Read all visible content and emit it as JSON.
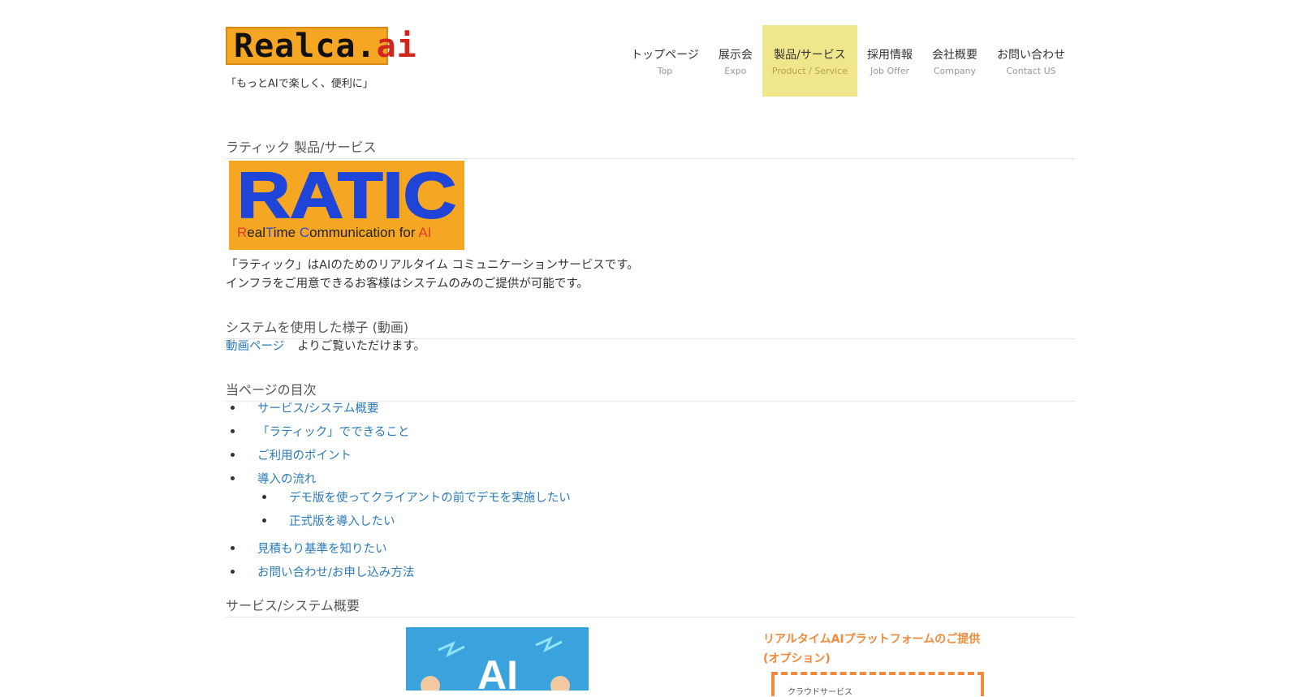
{
  "header": {
    "logo_main": "Realca.",
    "logo_accent": "ai",
    "tagline": "「もっとAIで楽しく、便利に」"
  },
  "nav": [
    {
      "jp": "トップページ",
      "en": "Top"
    },
    {
      "jp": "展示会",
      "en": "Expo"
    },
    {
      "jp": "製品/サービス",
      "en": "Product / Service",
      "active": true
    },
    {
      "jp": "採用情報",
      "en": "Job Offer"
    },
    {
      "jp": "会社概要",
      "en": "Company"
    },
    {
      "jp": "お問い合わせ",
      "en": "Contact US"
    }
  ],
  "section1": {
    "title": "ラティック 製品/サービス",
    "banner_big": "RATIC",
    "banner_sub_parts": [
      "R",
      "eal",
      "T",
      "ime ",
      "C",
      "ommunication for ",
      "AI"
    ],
    "desc1": "「ラティック」はAIのためのリアルタイム コミュニケーションサービスです。",
    "desc2": "インフラをご用意できるお客様はシステムのみのご提供が可能です。"
  },
  "section2": {
    "title": "システムを使用した様子 (動画)",
    "link": "動画ページ",
    "rest": "よりご覧いただけます。"
  },
  "toc": {
    "title": "当ページの目次",
    "items": [
      "サービス/システム概要",
      "「ラティック」でできること",
      "ご利用のポイント",
      "導入の流れ",
      "デモ版を使ってクライアントの前でデモを実施したい",
      "正式版を導入したい",
      "見積もり基準を知りたい",
      "お問い合わせ/お申し込み方法"
    ]
  },
  "section3": {
    "title": "サービス/システム概要",
    "illus_text": "AI",
    "side_title_1": "リアルタイムAIプラットフォームのご提供",
    "side_title_2": "(オプション)",
    "dash_label": "クラウドサービス"
  },
  "colors": {
    "accent": "#f5a623",
    "nav_active": "#f0e68c",
    "link": "#2a7ab9",
    "orange": "#f08a3c"
  }
}
